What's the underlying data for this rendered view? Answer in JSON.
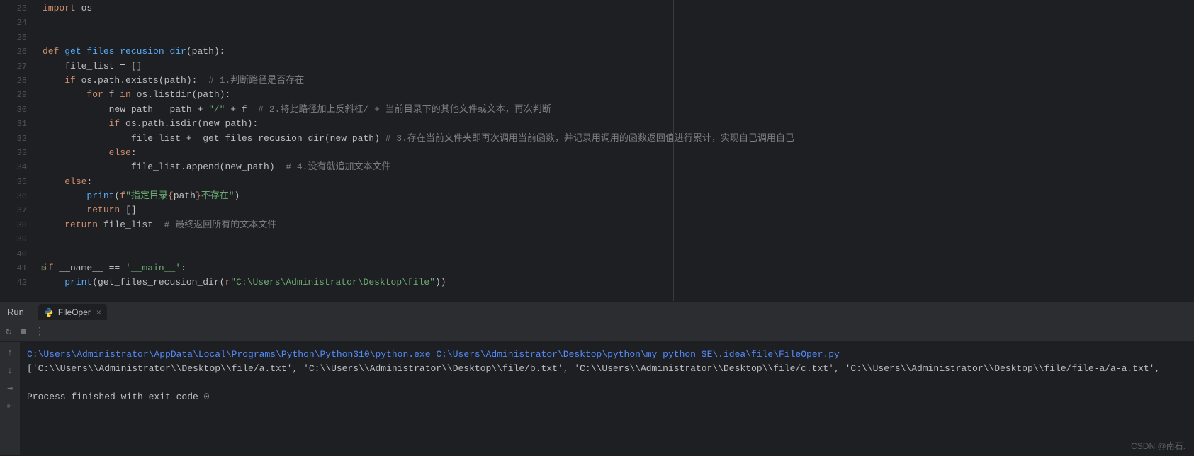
{
  "gutter": {
    "start": 23,
    "end": 42,
    "run_line": 41
  },
  "code": {
    "l23": {
      "kw1": "import",
      "mod": " os"
    },
    "l26": {
      "kw1": "def ",
      "fn": "get_files_recusion_dir",
      "rest": "(path):"
    },
    "l27": {
      "indent": "    ",
      "var": "file_list = []"
    },
    "l28": {
      "indent": "    ",
      "kw": "if ",
      "call": "os.path.exists(path):  ",
      "cmt": "# 1.判断路径是否存在"
    },
    "l29": {
      "indent": "        ",
      "kw": "for ",
      "var": "f ",
      "kw2": "in ",
      "call": "os.listdir(path):"
    },
    "l30": {
      "indent": "            ",
      "var": "new_path = path + ",
      "str": "\"/\"",
      "rest": " + f  ",
      "cmt": "# 2.将此路径加上反斜杠/ + 当前目录下的其他文件或文本，再次判断"
    },
    "l31": {
      "indent": "            ",
      "kw": "if ",
      "call": "os.path.isdir(new_path):"
    },
    "l32": {
      "indent": "                ",
      "var": "file_list += get_files_recusion_dir(new_path) ",
      "cmt": "# 3.存在当前文件夹即再次调用当前函数，并记录用调用的函数返回值进行累计，实现自己调用自己"
    },
    "l33": {
      "indent": "            ",
      "kw": "else",
      ":": ":"
    },
    "l34": {
      "indent": "                ",
      "call": "file_list.append(new_path)  ",
      "cmt": "# 4.没有就追加文本文件"
    },
    "l35": {
      "indent": "    ",
      "kw": "else",
      ":": ":"
    },
    "l36": {
      "indent": "        ",
      "fn": "print",
      "p": "(",
      "kw": "f",
      "s1": "\"指定目录",
      "br1": "{",
      "v": "path",
      "br2": "}",
      "s2": "不存在\"",
      ")": ")"
    },
    "l37": {
      "indent": "        ",
      "kw": "return ",
      "val": "[]"
    },
    "l38": {
      "indent": "    ",
      "kw": "return ",
      "val": "file_list  ",
      "cmt": "# 最终返回所有的文本文件"
    },
    "l41": {
      "kw": "if ",
      "var": "__name__ == ",
      "str": "'__main__'",
      ":": ":"
    },
    "l42": {
      "indent": "    ",
      "fn": "print",
      "rest": "(get_files_recusion_dir(",
      "kw": "r",
      "str": "\"C:\\Users\\Administrator\\Desktop\\file\"",
      "end": "))"
    }
  },
  "panel": {
    "title": "Run",
    "tab_name": "FileOper"
  },
  "console": {
    "link1": "C:\\Users\\Administrator\\AppData\\Local\\Programs\\Python\\Python310\\python.exe",
    "link2": "C:\\Users\\Administrator\\Desktop\\python\\my_python_SE\\.idea\\file\\FileOper.py",
    "output": "['C:\\\\Users\\\\Administrator\\\\Desktop\\\\file/a.txt', 'C:\\\\Users\\\\Administrator\\\\Desktop\\\\file/b.txt', 'C:\\\\Users\\\\Administrator\\\\Desktop\\\\file/c.txt', 'C:\\\\Users\\\\Administrator\\\\Desktop\\\\file/file-a/a-a.txt',",
    "exit": "Process finished with exit code 0"
  },
  "watermark": "CSDN @南石."
}
